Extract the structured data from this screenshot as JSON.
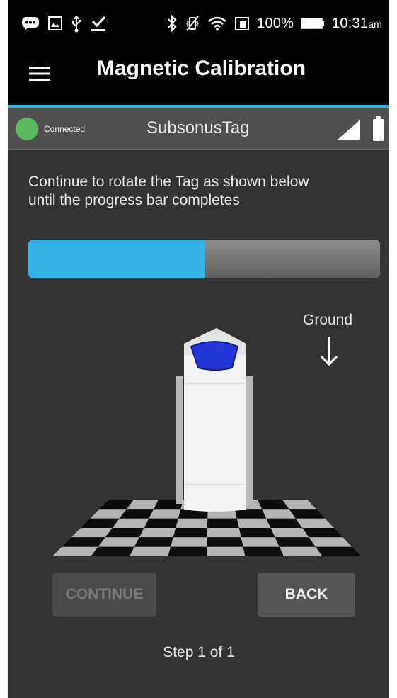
{
  "status_bar": {
    "icons_left": [
      "chat-bubble-icon",
      "image-icon",
      "usb-icon",
      "download-done-icon"
    ],
    "icons_right": [
      "bluetooth-icon",
      "vibrate-icon",
      "wifi-icon",
      "sim-icon",
      "battery-icon"
    ],
    "battery_percent": "100%",
    "time": "10:31",
    "ampm": "am"
  },
  "app_bar": {
    "menu_icon": "hamburger-menu-icon",
    "title": "Magnetic Calibration"
  },
  "device": {
    "status": "Connected",
    "status_color": "#5cb85c",
    "name": "SubsonusTag",
    "signal_icon": "signal-icon",
    "battery_icon": "battery-icon"
  },
  "calibration": {
    "instructions": "Continue to rotate the Tag as shown below until the progress bar completes",
    "progress": 0.5,
    "progress_color": "#33b3e5",
    "ground_label": "Ground",
    "ground_arrow_icon": "arrow-down-icon",
    "model_image": "tag-3d-model"
  },
  "actions": {
    "continue_label": "CONTINUE",
    "continue_enabled": false,
    "back_label": "BACK"
  },
  "step_text": "Step 1 of 1",
  "colors": {
    "accent": "#33b3e5",
    "background": "#333333",
    "appbar": "#000000"
  }
}
